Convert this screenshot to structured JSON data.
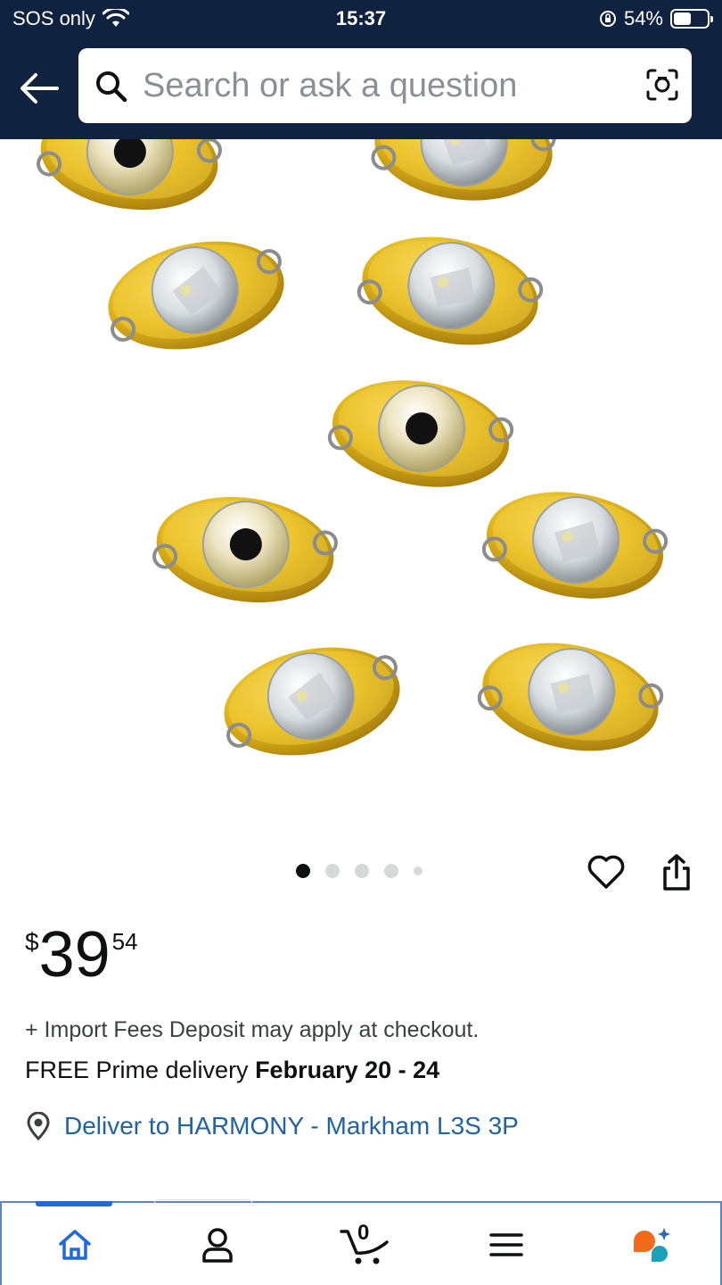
{
  "status_bar": {
    "carrier": "SOS only",
    "time": "15:37",
    "battery": "54%",
    "battery_level": 0.54
  },
  "search": {
    "placeholder": "Search or ask a question"
  },
  "gallery": {
    "image_count": 5,
    "active_index": 0
  },
  "price": {
    "currency": "$",
    "whole": "39",
    "fraction": "54"
  },
  "import_fees": "+ Import Fees Deposit may apply at checkout.",
  "delivery": {
    "prefix": "FREE Prime delivery ",
    "dates": "February 20 - 24"
  },
  "deliver_to": "Deliver to HARMONY - Markham L3S 3P",
  "bottom_nav": {
    "cart_count": "0",
    "items": [
      "home-icon",
      "account-icon",
      "cart-icon",
      "menu-icon",
      "assistant-icon"
    ]
  },
  "colors": {
    "header": "#0f2240",
    "link": "#2162a1",
    "nav_accent": "#1f6ad8",
    "gold": "#e7c12a"
  }
}
